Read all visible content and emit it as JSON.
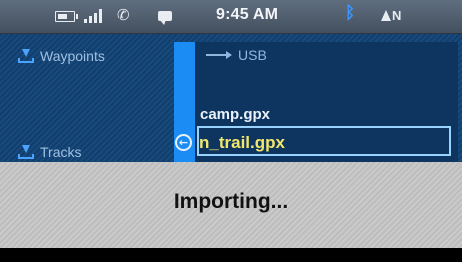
{
  "status_bar": {
    "time": "9:45 AM",
    "heading": "N",
    "icons": [
      "battery-icon",
      "signal-icon",
      "phone-icon",
      "message-icon",
      "bluetooth-icon",
      "north-arrow-icon"
    ]
  },
  "categories": [
    {
      "label": "Waypoints",
      "icon": "download-icon"
    },
    {
      "label": "Tracks",
      "icon": "download-icon"
    }
  ],
  "source": {
    "label": "USB",
    "icon": "usb-icon"
  },
  "files": [
    {
      "name": "camp.gpx",
      "selected": false
    },
    {
      "name": "n_trail.gpx",
      "selected": true
    }
  ],
  "overlay": {
    "message": "Importing..."
  },
  "colors": {
    "accent": "#1b8cf3",
    "selected_text": "#f2e66b",
    "background": "#0f3a66"
  }
}
